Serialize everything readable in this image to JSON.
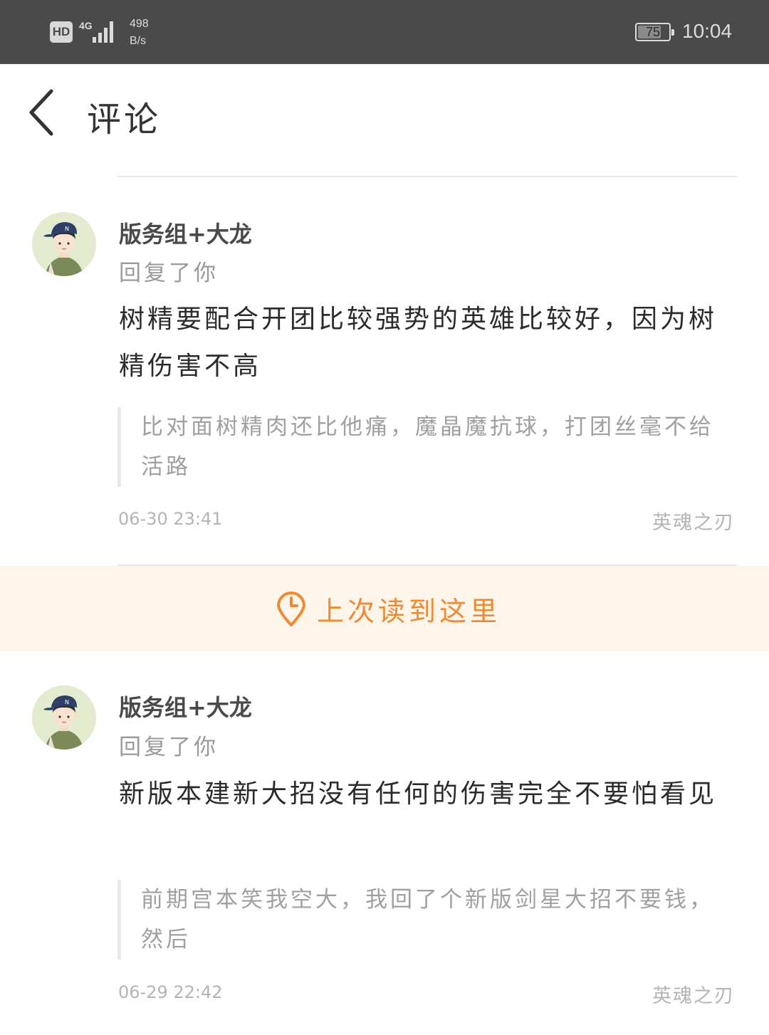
{
  "status_bar": {
    "hd_badge": "HD",
    "network": "4G",
    "speed_value": "498",
    "speed_unit": "B/s",
    "battery": "75",
    "battery_level": 0.75,
    "time": "10:04"
  },
  "header": {
    "title": "评论",
    "back_icon": "chevron-left-icon"
  },
  "comments": [
    {
      "username": "版务组+大龙",
      "reply_tag": "回复了你",
      "text": "树精要配合开团比较强势的英雄比较好，因为树精伤害不高",
      "quote": "比对面树精肉还比他痛，魔晶魔抗球，打团丝毫不给活路",
      "time": "06-30 23:41",
      "source": "英魂之刃"
    },
    {
      "username": "版务组+大龙",
      "reply_tag": "回复了你",
      "text": "新版本建新大招没有任何的伤害完全不要怕看见",
      "quote": "前期宫本笑我空大，我回了个新版剑星大招不要钱，然后",
      "time": "06-29 22:42",
      "source": "英魂之刃"
    }
  ],
  "read_marker": {
    "label": "上次读到这里",
    "icon": "location-clock-icon",
    "color": "#ee8a34"
  }
}
